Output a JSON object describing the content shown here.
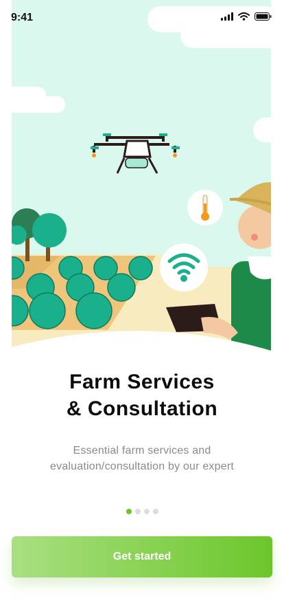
{
  "status_bar": {
    "time": "9:41"
  },
  "onboarding": {
    "title_line1": "Farm Services",
    "title_line2": "& Consultation",
    "subtitle_line1": "Essential farm services and",
    "subtitle_line2": "evaluation/consultation by our expert",
    "pagination": {
      "total": 4,
      "active_index": 0
    },
    "cta_label": "Get started"
  },
  "colors": {
    "accent": "#6cc62a",
    "sky": "#d9f7ee",
    "field": "#fbe7a3",
    "crop": "#1ab08b"
  }
}
